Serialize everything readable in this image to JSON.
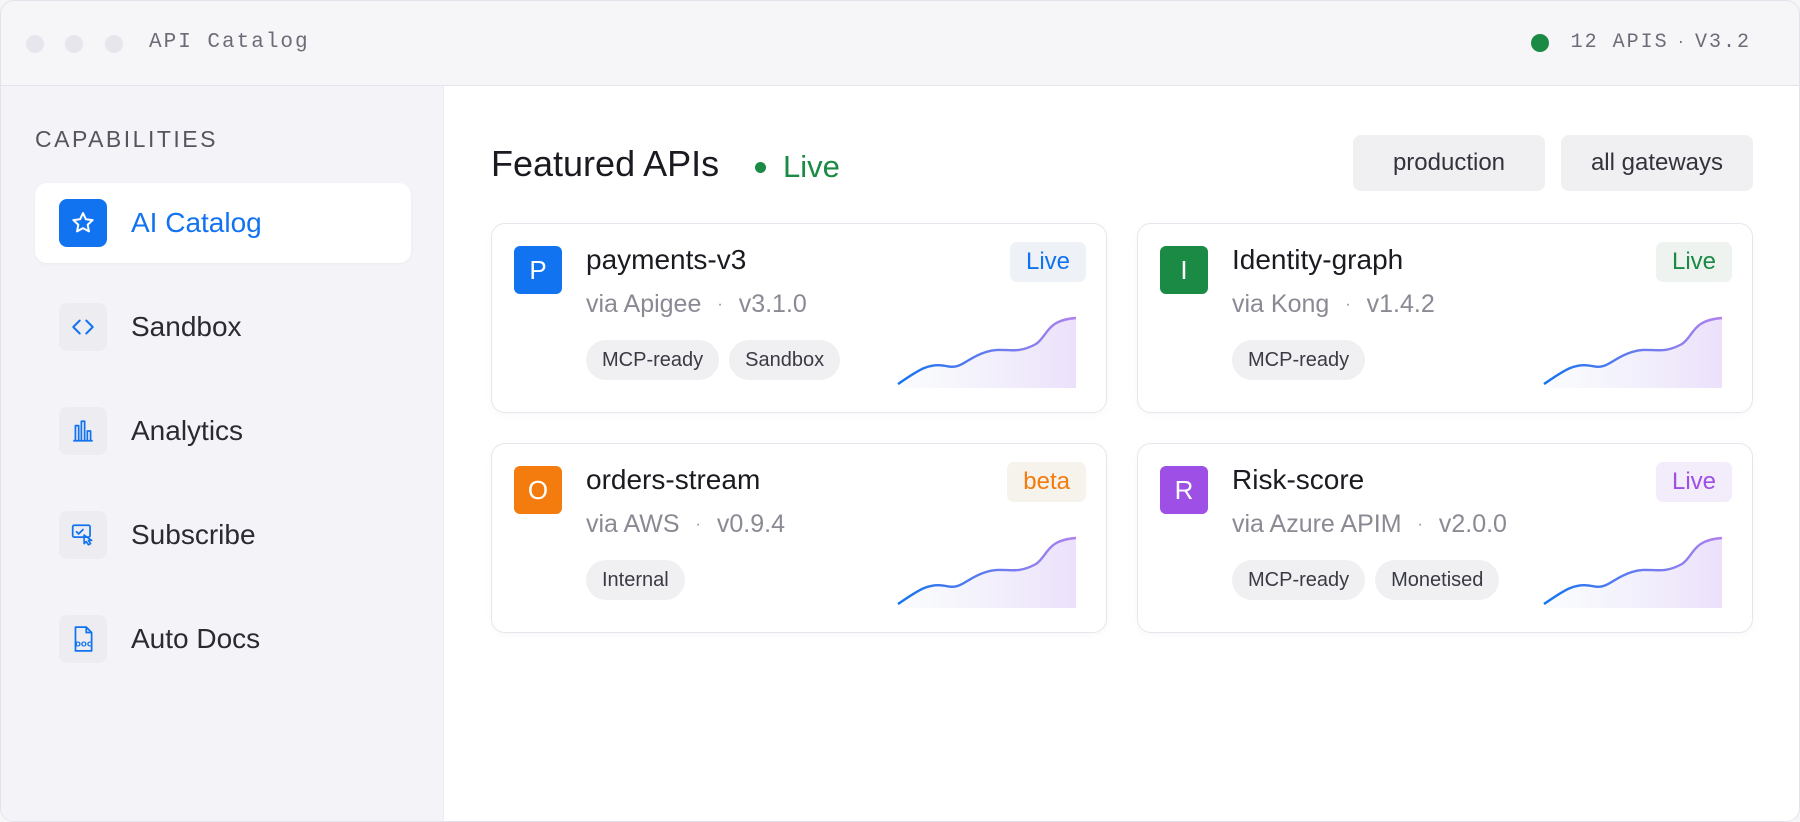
{
  "window": {
    "title": "API Catalog",
    "status_count": "12 APIS",
    "status_sep": "·",
    "version": "V3.2"
  },
  "sidebar": {
    "heading": "CAPABILITIES",
    "items": [
      {
        "label": "AI Catalog",
        "icon": "star-icon",
        "active": true
      },
      {
        "label": "Sandbox",
        "icon": "code-icon",
        "active": false
      },
      {
        "label": "Analytics",
        "icon": "bar-chart-icon",
        "active": false
      },
      {
        "label": "Subscribe",
        "icon": "subscribe-icon",
        "active": false
      },
      {
        "label": "Auto Docs",
        "icon": "doc-icon",
        "active": false
      }
    ]
  },
  "main": {
    "heading": "Featured APIs",
    "live_label": "Live",
    "filters": [
      "production",
      "all gateways"
    ],
    "cards": [
      {
        "initial": "P",
        "name": "payments-v3",
        "via": "via Apigee",
        "sep": "·",
        "version": "v3.1.0",
        "badge": "Live",
        "tags": [
          "MCP-ready",
          "Sandbox"
        ],
        "accent": "#1173f0",
        "badge_color": "#1173f0",
        "badge_bg": "#eef1f6"
      },
      {
        "initial": "I",
        "name": "Identity-graph",
        "via": "via Kong",
        "sep": "·",
        "version": "v1.4.2",
        "badge": "Live",
        "tags": [
          "MCP-ready"
        ],
        "accent": "#1a8a45",
        "badge_color": "#1a8a45",
        "badge_bg": "#eef3ef"
      },
      {
        "initial": "O",
        "name": "orders-stream",
        "via": "via AWS",
        "sep": "·",
        "version": "v0.9.4",
        "badge": "beta",
        "tags": [
          "Internal"
        ],
        "accent": "#f47c0e",
        "badge_color": "#f47c0e",
        "badge_bg": "#f6f2ec"
      },
      {
        "initial": "R",
        "name": "Risk-score",
        "via": "via Azure APIM",
        "sep": "·",
        "version": "v2.0.0",
        "badge": "Live",
        "tags": [
          "MCP-ready",
          "Monetised"
        ],
        "accent": "#9d4fe6",
        "badge_color": "#9d4fe6",
        "badge_bg": "#f3ecfb"
      }
    ]
  },
  "colors": {
    "accent": "#1173f0",
    "live": "#1a8a45"
  }
}
